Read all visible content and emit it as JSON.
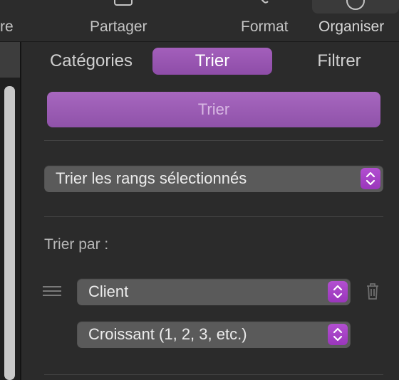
{
  "toolbar": {
    "left_partial": "re",
    "partager": "Partager",
    "format": "Format",
    "organiser": "Organiser"
  },
  "tabs": {
    "categories": "Catégories",
    "trier": "Trier",
    "filtrer": "Filtrer"
  },
  "trier_button": "Trier",
  "range_select": "Trier les rangs sélectionnés",
  "sort_by_label": "Trier par :",
  "sort_column": "Client",
  "sort_order": "Croissant (1, 2, 3, etc.)",
  "colors": {
    "accent": "#9b59b6",
    "stepper": "#a844c8"
  }
}
